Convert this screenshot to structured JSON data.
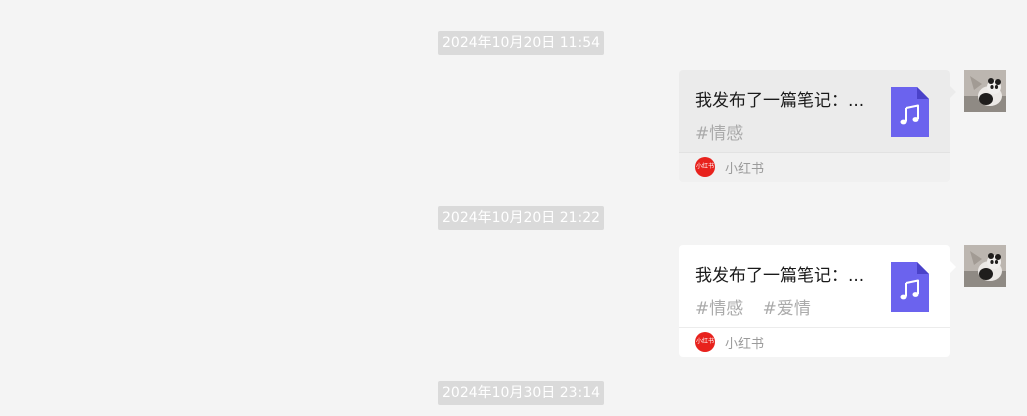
{
  "messages": [
    {
      "timestamp": "2024年10月20日 11:54",
      "card": {
        "title": "我发布了一篇笔记：...",
        "tags": [
          "#情感"
        ],
        "source_logo_text": "小红书",
        "source_name": "小红书",
        "file_icon": "music-file-icon"
      }
    },
    {
      "timestamp": "2024年10月20日 21:22",
      "card": {
        "title": "我发布了一篇笔记：...",
        "tags": [
          "#情感",
          "#爱情"
        ],
        "source_logo_text": "小红书",
        "source_name": "小红书",
        "file_icon": "music-file-icon"
      }
    }
  ],
  "trailing_timestamp": "2024年10月30日 23:14",
  "colors": {
    "background": "#f4f4f4",
    "timestamp_bg": "#dadada",
    "file_icon": "#6b63ee",
    "source_logo": "#e8221d"
  }
}
